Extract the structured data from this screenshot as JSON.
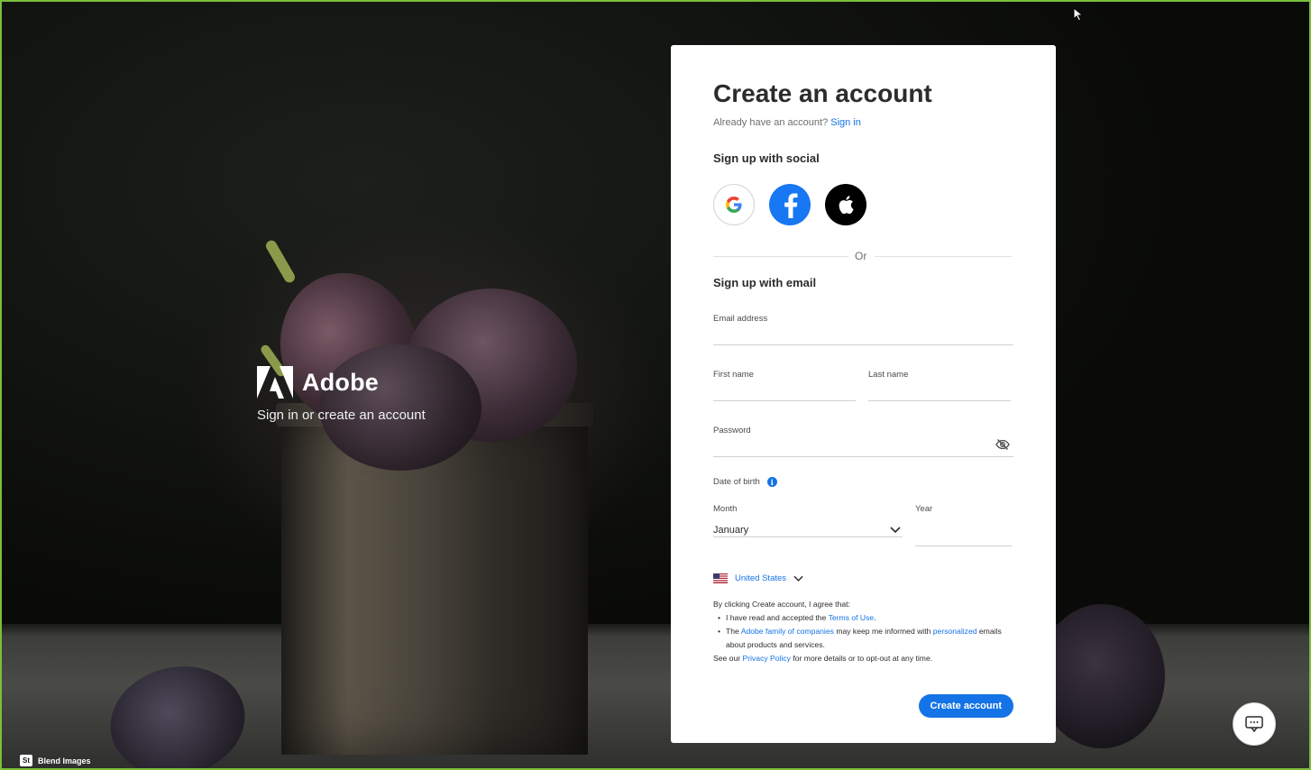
{
  "brand": {
    "name": "Adobe",
    "subtitle": "Sign in or create an account"
  },
  "form": {
    "title": "Create an account",
    "already_text": "Already have an account?",
    "sign_in_link": "Sign in",
    "social_heading": "Sign up with social",
    "social_buttons": [
      {
        "name": "google",
        "icon": "google-icon"
      },
      {
        "name": "facebook",
        "icon": "facebook-icon"
      },
      {
        "name": "apple",
        "icon": "apple-icon"
      }
    ],
    "or_text": "Or",
    "email_heading": "Sign up with email",
    "email_label": "Email address",
    "first_name_label": "First name",
    "last_name_label": "Last name",
    "password_label": "Password",
    "dob_label": "Date of birth",
    "month_label": "Month",
    "month_value": "January",
    "year_label": "Year",
    "country": "United States",
    "legal": {
      "intro": "By clicking Create account, I agree that:",
      "item1_prefix": "I have read and accepted the",
      "item1_link": "Terms of Use",
      "item1_suffix": ".",
      "item2_prefix": "The",
      "item2_link1": "Adobe family of companies",
      "item2_middle": "may keep me informed with",
      "item2_link2": "personalized",
      "item2_suffix": "emails about products and services.",
      "footer_prefix": "See our",
      "footer_link": "Privacy Policy",
      "footer_suffix": "for more details or to opt-out at any time."
    },
    "create_button": "Create account"
  },
  "credit": {
    "badge": "St",
    "text": "Blend Images"
  },
  "colors": {
    "accent": "#1473e6",
    "facebook": "#1877f2",
    "frame_border": "#7bbf3a"
  }
}
